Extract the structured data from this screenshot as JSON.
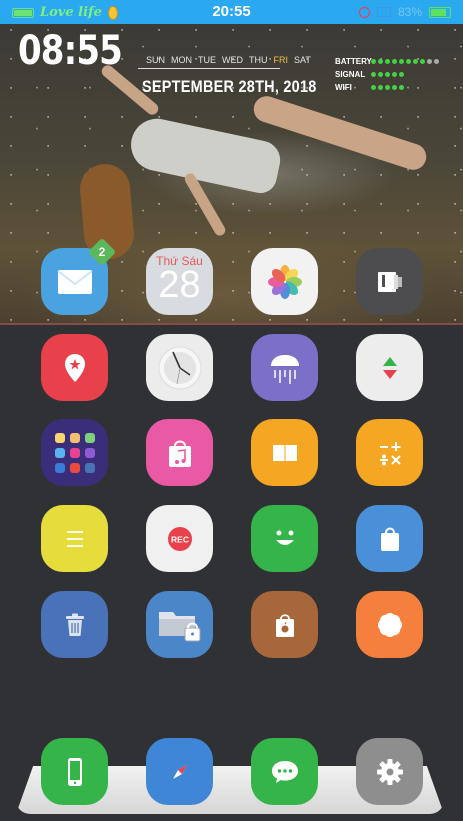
{
  "status_bar": {
    "carrier": "Love life",
    "time": "20:55",
    "battery_text": "83%",
    "battery_level_percent": 83
  },
  "widget": {
    "time": "08:55",
    "days": [
      "SUN",
      "MON",
      "TUE",
      "WED",
      "THU",
      "FRI",
      "SAT"
    ],
    "active_day_index": 5,
    "date": "SEPTEMBER 28TH, 2018",
    "stats": [
      {
        "label": "BATTERY",
        "dots_on": 8,
        "dots_total": 10
      },
      {
        "label": "SIGNAL",
        "dots_on": 5,
        "dots_total": 5
      },
      {
        "label": "WIFI",
        "dots_on": 5,
        "dots_total": 5
      }
    ],
    "colors": {
      "accent_day": "#f2c14e",
      "dot_on": "#46d046",
      "dot_off": "#aaaaaa"
    }
  },
  "apps": {
    "mail_badge": "2",
    "calendar_day": "Thứ Sáu",
    "calendar_date": "28",
    "record_label": "REC"
  },
  "icons": [
    {
      "name": "mail",
      "color": "#4aa3e0"
    },
    {
      "name": "calendar",
      "color": "#d8dbdf"
    },
    {
      "name": "photos",
      "color": "#f2f2f2"
    },
    {
      "name": "wallet",
      "color": "#4d4d4f"
    },
    {
      "name": "maps-pin",
      "color": "#e8414b"
    },
    {
      "name": "clock",
      "color": "#ececec"
    },
    {
      "name": "weather-rain",
      "color": "#7b6fc7"
    },
    {
      "name": "stocks",
      "color": "#ededed"
    },
    {
      "name": "folder-apps",
      "color": "#3a2d7a"
    },
    {
      "name": "music-store",
      "color": "#ea5aa4"
    },
    {
      "name": "books",
      "color": "#f5a623"
    },
    {
      "name": "calculator",
      "color": "#f5a623"
    },
    {
      "name": "notes-list",
      "color": "#e6dd3c"
    },
    {
      "name": "record",
      "color": "#f0f0f0"
    },
    {
      "name": "smile",
      "color": "#35b44a"
    },
    {
      "name": "store-bag",
      "color": "#4a90d9"
    },
    {
      "name": "trash",
      "color": "#4a72b8"
    },
    {
      "name": "secure-folder",
      "color": "#4a86c8"
    },
    {
      "name": "apple-bag",
      "color": "#a8673a"
    },
    {
      "name": "flower",
      "color": "#f57f3c"
    },
    {
      "name": "phone",
      "color": "#35b44a"
    },
    {
      "name": "safari-compass",
      "color": "#3f86d6"
    },
    {
      "name": "messages",
      "color": "#35b44a"
    },
    {
      "name": "settings-gear",
      "color": "#8e8e8e"
    }
  ]
}
